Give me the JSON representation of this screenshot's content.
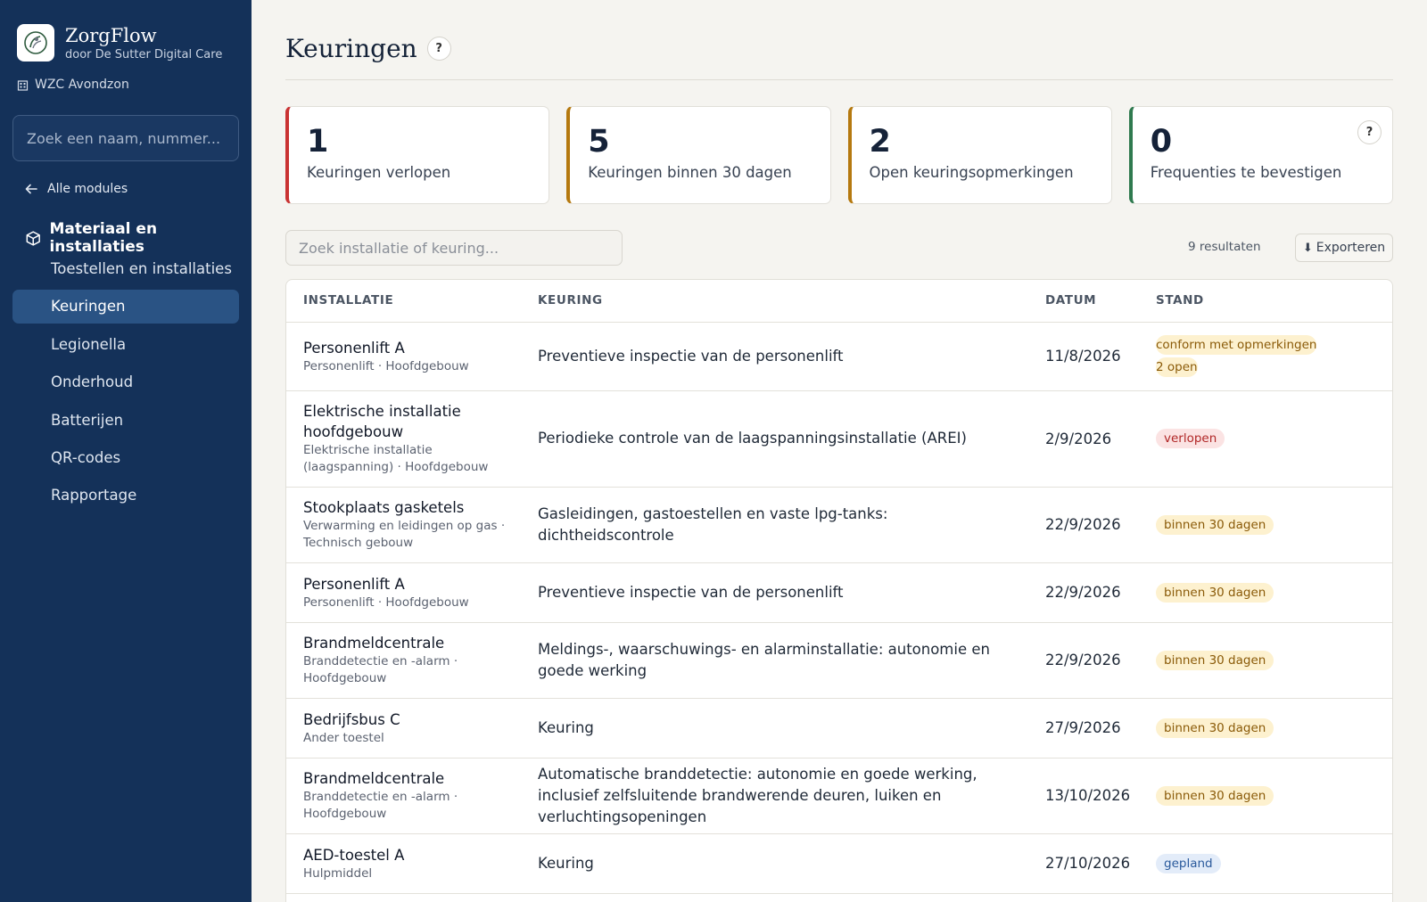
{
  "app": {
    "name": "ZorgFlow",
    "subtitle": "door De Sutter Digital Care",
    "facility": "WZC Avondzon"
  },
  "sidebar": {
    "search_placeholder": "Zoek een naam, nummer...",
    "back_label": "Alle modules",
    "module_title": "Materiaal en installaties",
    "items": [
      {
        "label": "Toestellen en installaties",
        "active": false
      },
      {
        "label": "Keuringen",
        "active": true
      },
      {
        "label": "Legionella",
        "active": false
      },
      {
        "label": "Onderhoud",
        "active": false
      },
      {
        "label": "Batterijen",
        "active": false
      },
      {
        "label": "QR-codes",
        "active": false
      },
      {
        "label": "Rapportage",
        "active": false
      }
    ]
  },
  "page": {
    "title": "Keuringen",
    "help": "?"
  },
  "cards": [
    {
      "value": "1",
      "label": "Keuringen verlopen",
      "accent": "#c93333"
    },
    {
      "value": "5",
      "label": "Keuringen binnen 30 dagen",
      "accent": "#b5790f"
    },
    {
      "value": "2",
      "label": "Open keuringsopmerkingen",
      "accent": "#b5790f"
    },
    {
      "value": "0",
      "label": "Frequenties te bevestigen",
      "accent": "#2f7a4f",
      "help": "?"
    }
  ],
  "toolbar": {
    "search_placeholder": "Zoek installatie of keuring...",
    "results": "9 resultaten",
    "export_label": "Exporteren"
  },
  "table": {
    "columns": [
      "INSTALLATIE",
      "KEURING",
      "DATUM",
      "STAND"
    ],
    "rows": [
      {
        "name": "Personenlift A",
        "sub": "Personenlift · Hoofdgebouw",
        "keuring": "Preventieve inspectie van de personenlift",
        "datum": "11/8/2026",
        "badges": [
          {
            "text": "conform met opmerkingen",
            "tone": "warn"
          },
          {
            "text": "2 open",
            "tone": "warn"
          }
        ]
      },
      {
        "name": "Elektrische installatie hoofdgebouw",
        "sub": "Elektrische installatie (laagspanning) · Hoofdgebouw",
        "keuring": "Periodieke controle van de laagspanningsinstallatie (AREI)",
        "datum": "2/9/2026",
        "badges": [
          {
            "text": "verlopen",
            "tone": "red"
          }
        ]
      },
      {
        "name": "Stookplaats gasketels",
        "sub": "Verwarming en leidingen op gas · Technisch gebouw",
        "keuring": "Gasleidingen, gastoestellen en vaste lpg-tanks: dichtheidscontrole",
        "datum": "22/9/2026",
        "badges": [
          {
            "text": "binnen 30 dagen",
            "tone": "warn"
          }
        ]
      },
      {
        "name": "Personenlift A",
        "sub": "Personenlift · Hoofdgebouw",
        "keuring": "Preventieve inspectie van de personenlift",
        "datum": "22/9/2026",
        "badges": [
          {
            "text": "binnen 30 dagen",
            "tone": "warn"
          }
        ]
      },
      {
        "name": "Brandmeldcentrale",
        "sub": "Branddetectie en -alarm · Hoofdgebouw",
        "keuring": "Meldings-, waarschuwings- en alarminstallatie: autonomie en goede werking",
        "datum": "22/9/2026",
        "badges": [
          {
            "text": "binnen 30 dagen",
            "tone": "warn"
          }
        ]
      },
      {
        "name": "Bedrijfsbus C",
        "sub": "Ander toestel",
        "keuring": "Keuring",
        "datum": "27/9/2026",
        "badges": [
          {
            "text": "binnen 30 dagen",
            "tone": "warn"
          }
        ]
      },
      {
        "name": "Brandmeldcentrale",
        "sub": "Branddetectie en -alarm · Hoofdgebouw",
        "keuring": "Automatische branddetectie: autonomie en goede werking, inclusief zelfsluitende brandwerende deuren, luiken en verluchtingsopeningen",
        "datum": "13/10/2026",
        "badges": [
          {
            "text": "binnen 30 dagen",
            "tone": "warn"
          }
        ]
      },
      {
        "name": "AED-toestel A",
        "sub": "Hulpmiddel",
        "keuring": "Keuring",
        "datum": "27/10/2026",
        "badges": [
          {
            "text": "gepland",
            "tone": "blue"
          }
        ]
      }
    ]
  }
}
